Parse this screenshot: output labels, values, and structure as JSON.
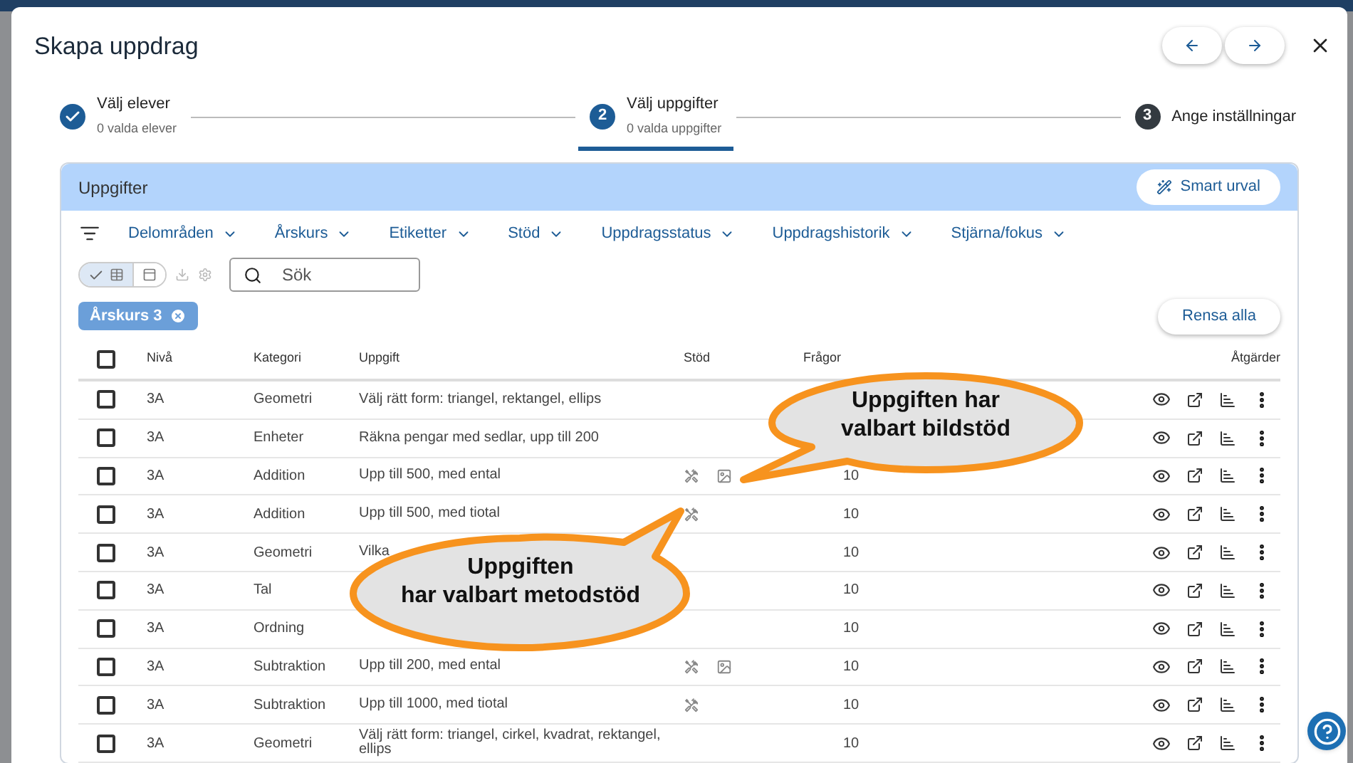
{
  "dialog": {
    "title": "Skapa uppdrag"
  },
  "steps": [
    {
      "label": "Välj elever",
      "sublabel": "0 valda elever",
      "completed": true,
      "selected": false
    },
    {
      "label": "Välj uppgifter",
      "sublabel": "0 valda uppgifter",
      "completed": false,
      "selected": true,
      "number": "2"
    },
    {
      "label": "Ange inställningar",
      "completed": false,
      "selected": false,
      "number": "3"
    }
  ],
  "panel": {
    "title": "Uppgifter",
    "smart_button": "Smart urval"
  },
  "filters": [
    "Delområden",
    "Årskurs",
    "Etiketter",
    "Stöd",
    "Uppdragsstatus",
    "Uppdragshistorik",
    "Stjärna/fokus"
  ],
  "view_toggle": [
    {
      "kind": "table",
      "selected": true
    },
    {
      "kind": "rows",
      "selected": false
    }
  ],
  "search": {
    "placeholder": "Sök"
  },
  "chips": [
    "Årskurs 3"
  ],
  "clear_button": "Rensa alla",
  "table": {
    "all_checked": false,
    "columns": [
      "Nivå",
      "Kategori",
      "Uppgift",
      "Stöd",
      "Frågor",
      "Åtgärder"
    ],
    "rows": [
      {
        "checked": false,
        "level_text": "3A",
        "category": "Geometri",
        "task": "Välj rätt form: triangel, rektangel, ellips",
        "method_support": false,
        "image_support": false
      },
      {
        "checked": false,
        "level_text": "3A",
        "category": "Enheter",
        "task": "Räkna pengar med sedlar, upp till 200",
        "method_support": false,
        "image_support": false
      },
      {
        "checked": false,
        "level_text": "3A",
        "category": "Addition",
        "task": "Upp till 500, med ental",
        "method_support": true,
        "image_support": true,
        "questions": "10"
      },
      {
        "checked": false,
        "level_text": "3A",
        "category": "Addition",
        "task": "Upp till 500, med tiotal",
        "method_support": true,
        "image_support": false,
        "questions": "10"
      },
      {
        "checked": false,
        "level_text": "3A",
        "category": "Geometri",
        "task": "Vilka",
        "method_support": false,
        "image_support": false,
        "questions": "10"
      },
      {
        "checked": false,
        "level_text": "3A",
        "category": "Tal",
        "method_support": false,
        "image_support": false,
        "questions": "10"
      },
      {
        "checked": false,
        "level_text": "3A",
        "category": "Ordning",
        "method_support": false,
        "image_support": false,
        "questions": "10"
      },
      {
        "checked": false,
        "level_text": "3A",
        "category": "Subtraktion",
        "task": "Upp till 200, med ental",
        "method_support": true,
        "image_support": true,
        "questions": "10"
      },
      {
        "checked": false,
        "level_text": "3A",
        "category": "Subtraktion",
        "task": "Upp till 1000, med tiotal",
        "method_support": true,
        "image_support": false,
        "questions": "10"
      },
      {
        "checked": false,
        "level_text": "3A",
        "category": "Geometri",
        "task": "Välj rätt form: triangel, cirkel, kvadrat, rektangel, ellips",
        "method_support": false,
        "image_support": false,
        "questions": "10"
      }
    ]
  },
  "callouts": [
    {
      "kind": "upper",
      "lines": [
        "Uppgiften har",
        "valbart bildstöd"
      ]
    },
    {
      "kind": "lower",
      "lines": [
        "Uppgiften",
        "har valbart metodstöd"
      ]
    }
  ]
}
